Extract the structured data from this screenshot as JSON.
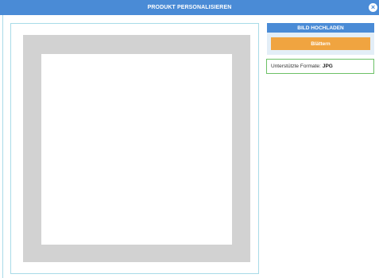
{
  "header": {
    "title": "PRODUKT PERSONALISIEREN",
    "close_symbol": "×"
  },
  "upload": {
    "title": "BILD HOCHLADEN",
    "browse_label": "Blättern"
  },
  "formats": {
    "label": "Unterstützte Formate:",
    "value": "JPG"
  },
  "colors": {
    "header_blue": "#4a8bd6",
    "browse_orange": "#f0a440",
    "formats_border_green": "#6cc166",
    "canvas_border": "#a8dbe8",
    "canvas_gray": "#d2d2d2"
  },
  "icons": {
    "close": "close-icon"
  }
}
